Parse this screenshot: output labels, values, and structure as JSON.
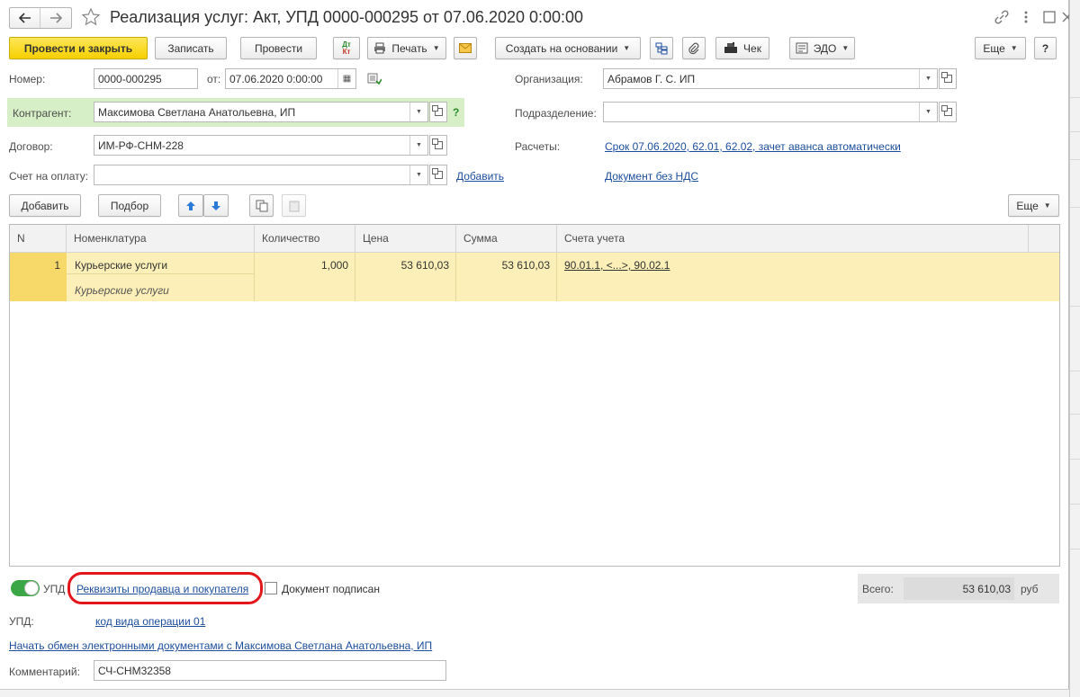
{
  "window": {
    "title": "Реализация услуг: Акт, УПД 0000-000295 от 07.06.2020 0:00:00"
  },
  "toolbar": {
    "post_close": "Провести и закрыть",
    "save": "Записать",
    "post": "Провести",
    "print": "Печать",
    "create_based": "Создать на основании",
    "check": "Чек",
    "edo": "ЭДО",
    "more": "Еще",
    "help": "?",
    "dtkt_dt": "Дт",
    "dtkt_kt": "Кт"
  },
  "form": {
    "number_label": "Номер:",
    "number_value": "0000-000295",
    "from_label": "от:",
    "date_value": "07.06.2020  0:00:00",
    "org_label": "Организация:",
    "org_value": "Абрамов Г. С. ИП",
    "contractor_label": "Контрагент:",
    "contractor_value": "Максимова Светлана Анатольевна, ИП",
    "contractor_help": "?",
    "division_label": "Подразделение:",
    "division_value": "",
    "contract_label": "Договор:",
    "contract_value": "ИМ-РФ-СНМ-228",
    "settlements_label": "Расчеты:",
    "settlements_link": "Срок 07.06.2020, 62.01, 62.02, зачет аванса автоматически",
    "invoice_label": "Счет на оплату:",
    "invoice_value": "",
    "invoice_add_link": "Добавить",
    "vat_link": "Документ без НДС"
  },
  "table_toolbar": {
    "add": "Добавить",
    "pick": "Подбор",
    "more": "Еще"
  },
  "table": {
    "columns": [
      "N",
      "Номенклатура",
      "Количество",
      "Цена",
      "Сумма",
      "Счета учета"
    ],
    "rows": [
      {
        "n": "1",
        "item": "Курьерские услуги",
        "item_sub": "Курьерские услуги",
        "qty": "1,000",
        "price": "53 610,03",
        "sum": "53 610,03",
        "accounts": "90.01.1, <...>, 90.02.1"
      }
    ]
  },
  "footer": {
    "upd_toggle_label": "УПД",
    "requisites_link": "Реквизиты продавца и покупателя",
    "signed_label": "Документ подписан",
    "total_label": "Всего:",
    "total_value": "53 610,03",
    "total_currency": "руб",
    "upd_label": "УПД:",
    "op_code_link": "код вида операции 01",
    "edo_link": "Начать обмен электронными документами с Максимова Светлана Анатольевна, ИП",
    "comment_label": "Комментарий:",
    "comment_value": "СЧ-СНМ32358"
  },
  "colors": {
    "accent_yellow": "#f6d000",
    "row_highlight": "#fcf0b8",
    "link": "#1c4e9c",
    "toggle_green": "#3aa646",
    "annotation_red": "#e3161b"
  }
}
